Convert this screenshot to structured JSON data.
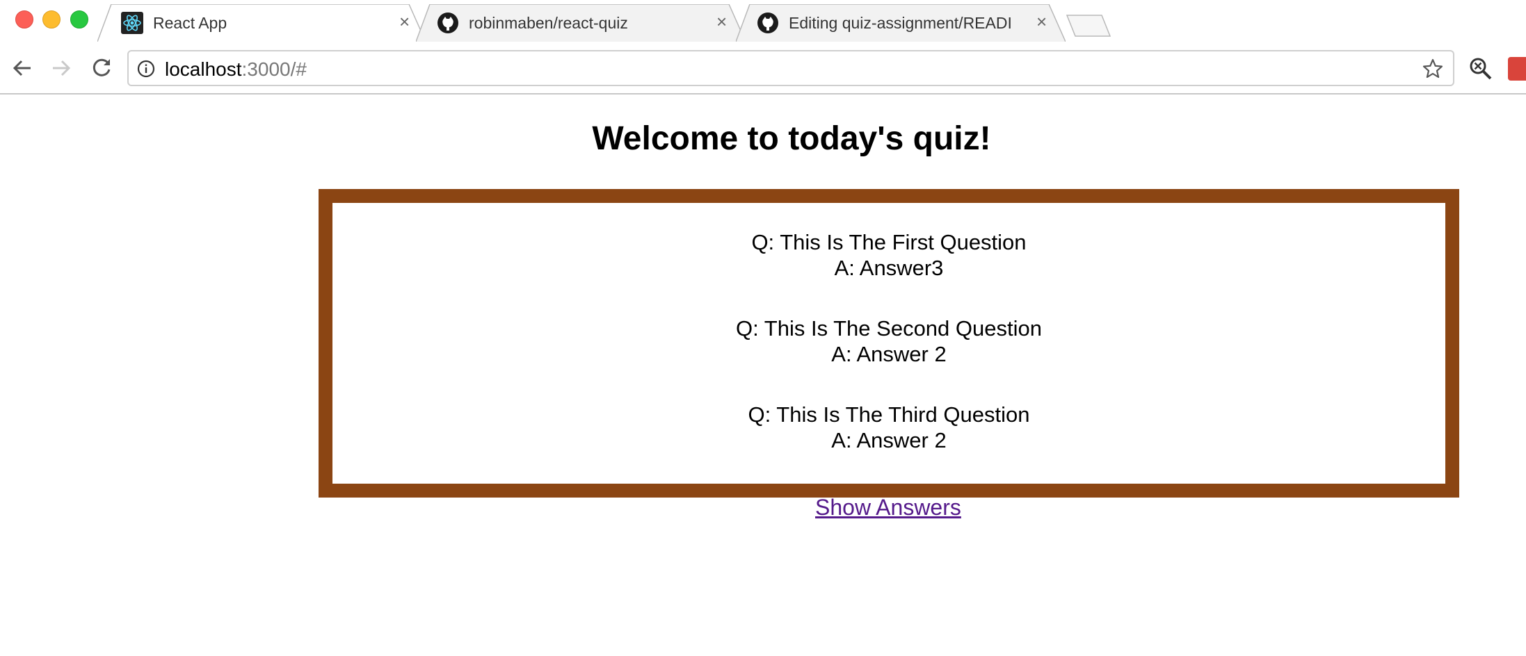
{
  "browser": {
    "tabs": [
      {
        "title": "React App",
        "icon": "react-icon",
        "active": true
      },
      {
        "title": "robinmaben/react-quiz",
        "icon": "github-icon",
        "active": false
      },
      {
        "title": "Editing quiz-assignment/READI",
        "icon": "github-icon",
        "active": false
      }
    ],
    "close_glyph": "×",
    "url_host": "localhost",
    "url_rest": ":3000/#"
  },
  "page": {
    "title": "Welcome to today's quiz!",
    "items": [
      {
        "question": "Q: This Is The First Question",
        "answer": "A: Answer3"
      },
      {
        "question": "Q: This Is The Second Question",
        "answer": "A: Answer 2"
      },
      {
        "question": "Q: This Is The Third Question",
        "answer": "A: Answer 2"
      }
    ],
    "show_answers_label": "Show Answers"
  },
  "colors": {
    "quiz_border": "#8b4513",
    "link_visited": "#551a8b"
  }
}
